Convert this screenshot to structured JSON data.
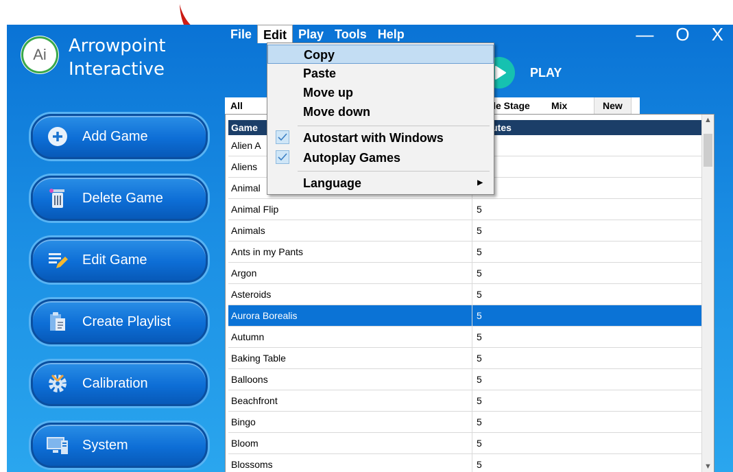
{
  "app": {
    "logo_text": "Ai",
    "name_line1": "Arrowpoint",
    "name_line2": "Interactive"
  },
  "menubar": {
    "items": [
      "File",
      "Edit",
      "Play",
      "Tools",
      "Help"
    ],
    "active": "Edit"
  },
  "window_controls": {
    "minimize": "—",
    "maximize": "O",
    "close": "X"
  },
  "play": {
    "label": "PLAY",
    "color": "#16c1b0"
  },
  "sidebar": {
    "buttons": [
      {
        "label": "Add Game",
        "icon": "plus-circle-icon"
      },
      {
        "label": "Delete Game",
        "icon": "trash-icon"
      },
      {
        "label": "Edit Game",
        "icon": "edit-list-icon"
      },
      {
        "label": "Create Playlist",
        "icon": "clipboard-icon"
      },
      {
        "label": "Calibration",
        "icon": "gear-icon"
      },
      {
        "label": "System",
        "icon": "monitor-icon"
      }
    ]
  },
  "tabs": {
    "all": "All",
    "middle_stage": "ddle Stage",
    "mix": "Mix",
    "new": "New"
  },
  "grid": {
    "col_name": "Game",
    "col_minutes": "Minutes",
    "hidden_names": [
      "Alien A",
      "Aliens",
      "Animal"
    ],
    "rows": [
      {
        "name": "Animal Flip",
        "minutes": "5"
      },
      {
        "name": "Animals",
        "minutes": "5"
      },
      {
        "name": "Ants in my Pants",
        "minutes": "5"
      },
      {
        "name": "Argon",
        "minutes": "5"
      },
      {
        "name": "Asteroids",
        "minutes": "5"
      },
      {
        "name": "Aurora Borealis",
        "minutes": "5",
        "selected": true
      },
      {
        "name": "Autumn",
        "minutes": "5"
      },
      {
        "name": "Baking Table",
        "minutes": "5"
      },
      {
        "name": "Balloons",
        "minutes": "5"
      },
      {
        "name": "Beachfront",
        "minutes": "5"
      },
      {
        "name": "Bingo",
        "minutes": "5"
      },
      {
        "name": "Bloom",
        "minutes": "5"
      },
      {
        "name": "Blossoms",
        "minutes": "5"
      }
    ]
  },
  "edit_menu": {
    "copy": "Copy",
    "paste": "Paste",
    "move_up": "Move up",
    "move_down": "Move down",
    "autostart": "Autostart with Windows",
    "autoplay": "Autoplay Games",
    "language": "Language",
    "autostart_checked": true,
    "autoplay_checked": true
  },
  "colors": {
    "accent": "#0b73d6",
    "header": "#1b3e68",
    "annotation_arrow": "#e8241c"
  }
}
